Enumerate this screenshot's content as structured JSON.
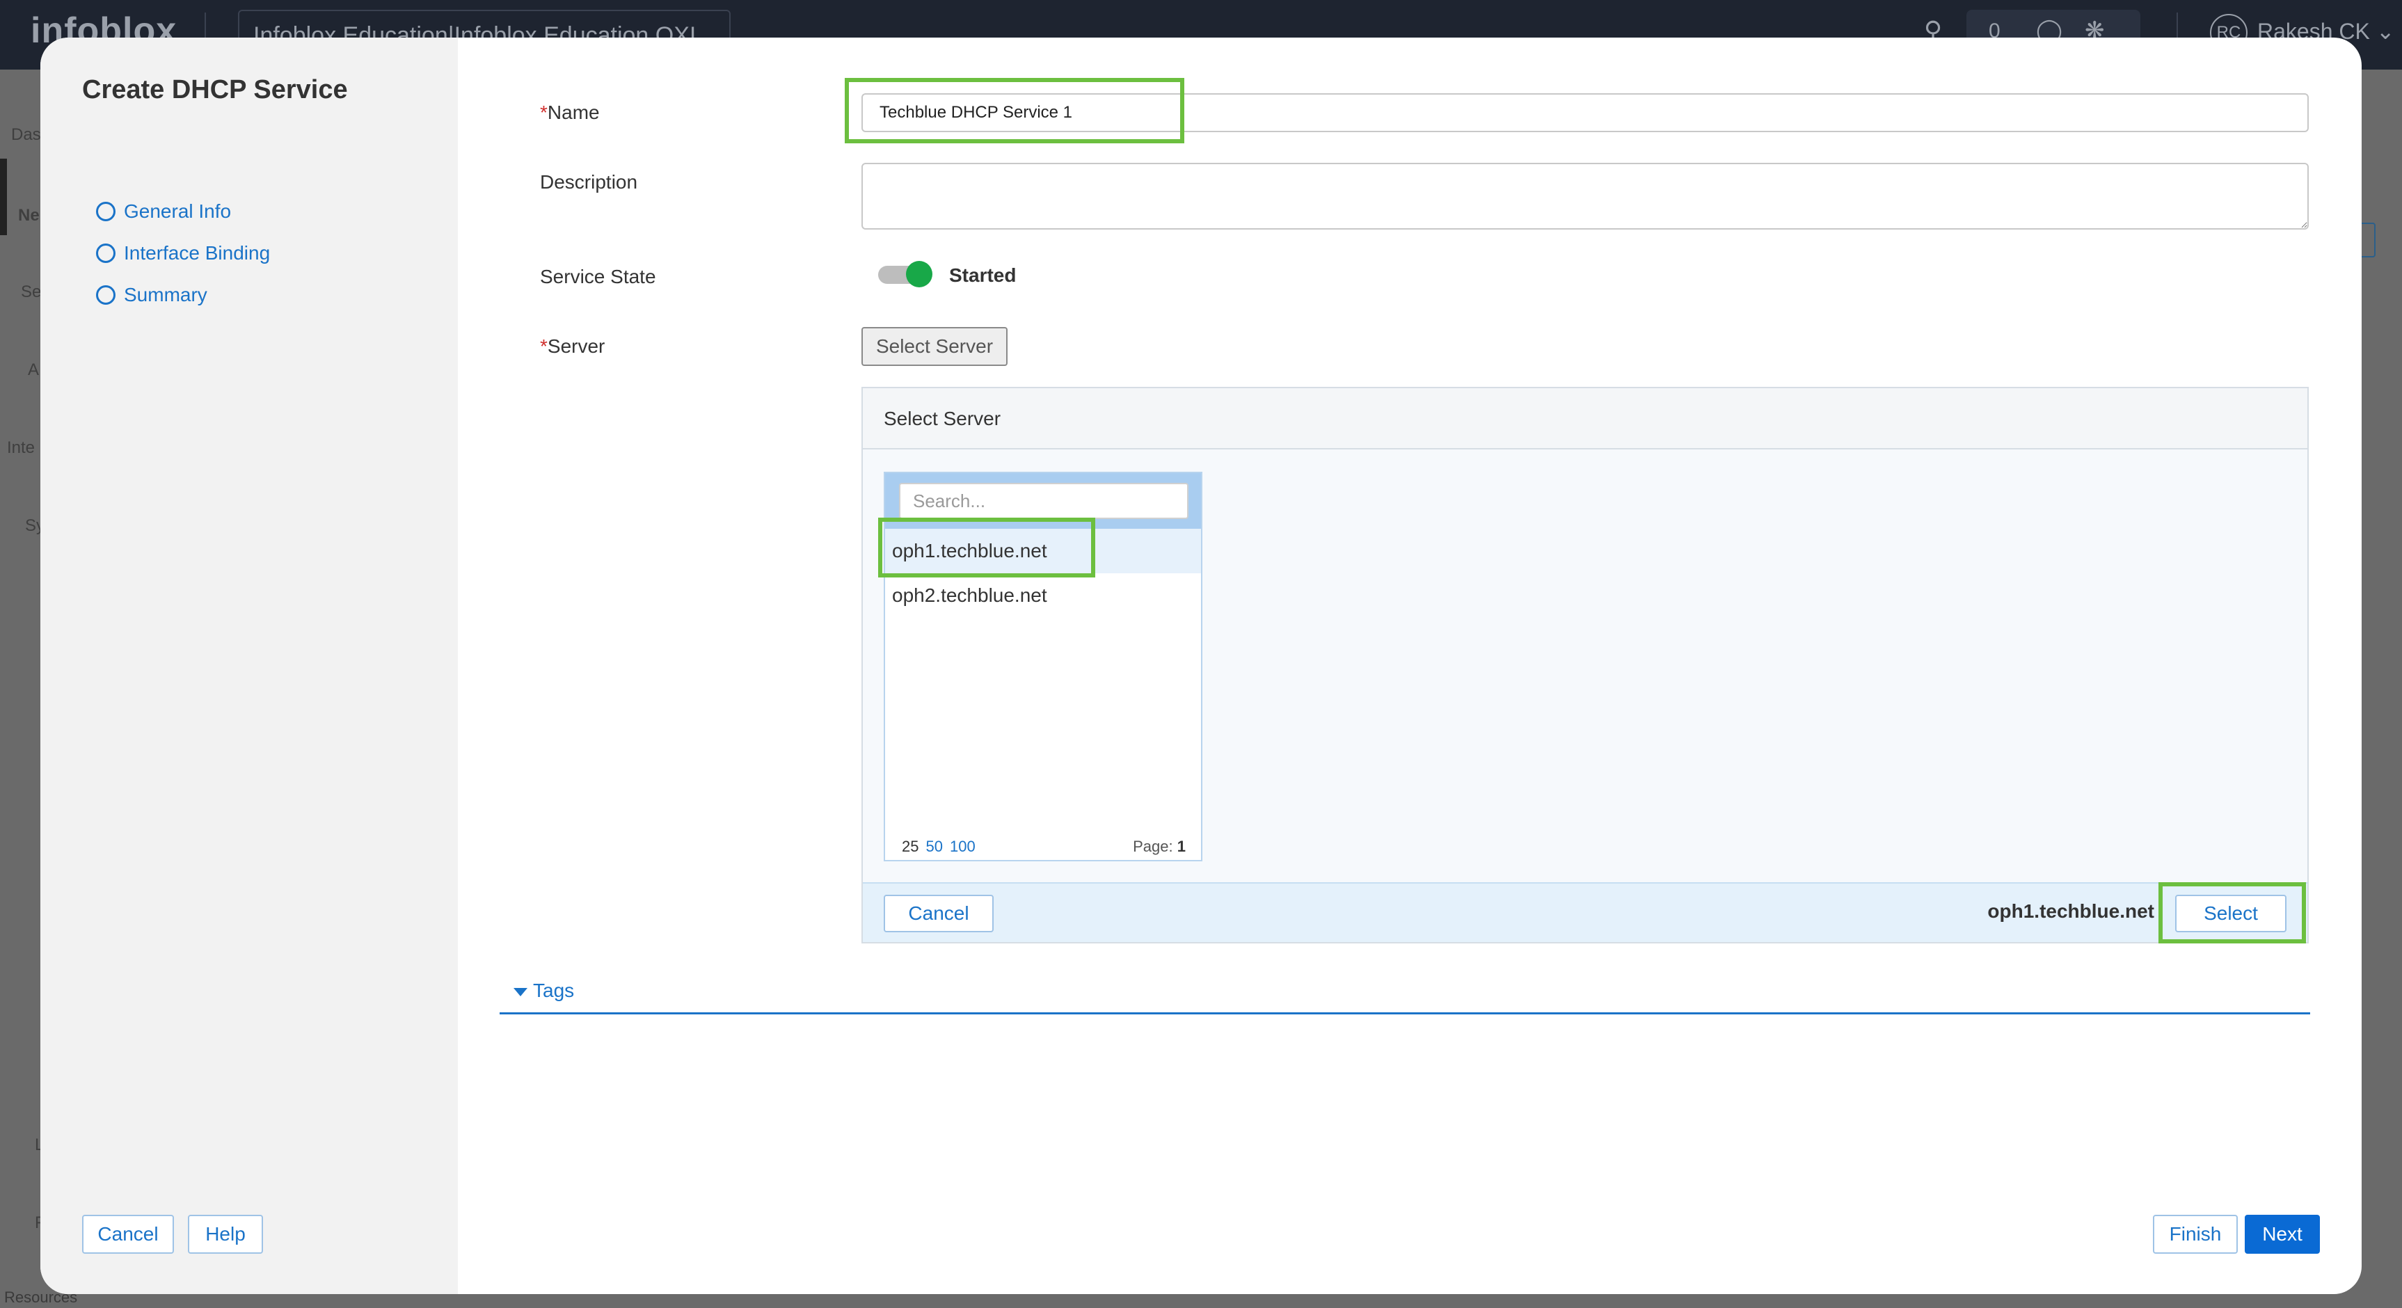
{
  "background": {
    "logo": "infoblox",
    "account": "Infoblox Education|Infoblox Education OXI",
    "notification_count": "0",
    "user_initials": "RC",
    "user_name": "Rakesh CK",
    "nav_items": [
      "Das",
      "Ne",
      "Se",
      "A",
      "Inte",
      "Sy",
      "L",
      "F"
    ],
    "footer_link": "Resources"
  },
  "modal": {
    "title": "Create DHCP Service",
    "steps": [
      {
        "label": "General Info"
      },
      {
        "label": "Interface Binding"
      },
      {
        "label": "Summary"
      }
    ],
    "cancel_label": "Cancel",
    "help_label": "Help",
    "finish_label": "Finish",
    "next_label": "Next"
  },
  "form": {
    "required_mark": "*",
    "name_label": "Name",
    "name_value": "Techblue DHCP Service 1",
    "description_label": "Description",
    "description_value": "",
    "state_label": "Service State",
    "state_value": "Started",
    "server_label": "Server",
    "select_server_button": "Select Server"
  },
  "server_panel": {
    "title": "Select Server",
    "search_placeholder": "Search...",
    "servers": [
      {
        "name": "oph1.techblue.net",
        "selected": true
      },
      {
        "name": "oph2.techblue.net",
        "selected": false
      }
    ],
    "page_sizes": [
      "25",
      "50",
      "100"
    ],
    "page_label": "Page:",
    "page_number": "1",
    "cancel_label": "Cancel",
    "selected_server": "oph1.techblue.net",
    "select_label": "Select"
  },
  "tags": {
    "label": "Tags"
  },
  "colors": {
    "accent": "#1a73c8",
    "primary_button": "#0a6ad4",
    "toggle_on": "#18a848",
    "highlight_box": "#6cbf3f",
    "required": "#d0302e"
  }
}
